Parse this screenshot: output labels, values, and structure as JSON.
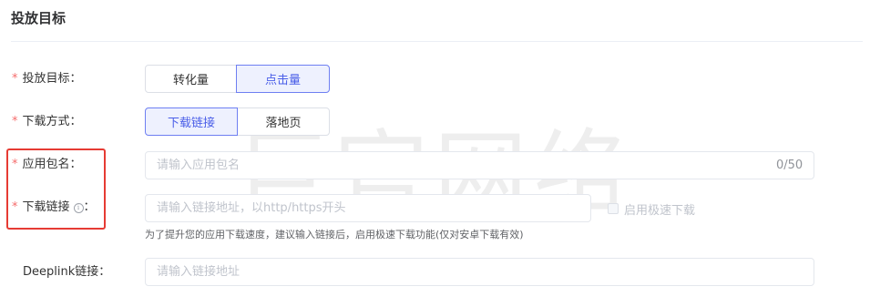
{
  "section": {
    "title": "投放目标"
  },
  "watermark": "巨官网络",
  "fields": {
    "goal": {
      "required": "*",
      "label": "投放目标：",
      "options": [
        "转化量",
        "点击量"
      ],
      "selected": "点击量"
    },
    "download_method": {
      "required": "*",
      "label": "下载方式：",
      "options": [
        "下载链接",
        "落地页"
      ],
      "selected": "下载链接"
    },
    "package_name": {
      "required": "*",
      "label": "应用包名：",
      "value": "",
      "placeholder": "请输入应用包名",
      "counter": "0/50"
    },
    "download_link": {
      "required": "*",
      "label": "下载链接",
      "label_suffix": "：",
      "info_icon": "i",
      "value": "",
      "placeholder": "请输入链接地址，以http/https开头",
      "checkbox_label": "启用极速下载",
      "checkbox_checked": false,
      "hint": "为了提升您的应用下载速度，建议输入链接后，启用极速下载功能(仅对安卓下载有效)"
    },
    "deeplink": {
      "label": "Deeplink链接：",
      "value": "",
      "placeholder": "请输入链接地址"
    }
  },
  "colors": {
    "required": "#f56c6c",
    "accent": "#4a5ee8",
    "highlight_border": "#e63b34"
  }
}
